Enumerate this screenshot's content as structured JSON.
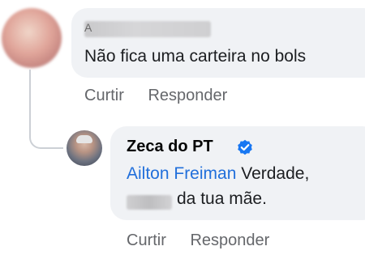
{
  "comment": {
    "author_redacted_visible_char": "A",
    "text": "Não fica uma carteira no bols",
    "actions": {
      "like": "Curtir",
      "reply": "Responder"
    }
  },
  "reply": {
    "author": "Zeca do PT",
    "verified": true,
    "mention": "Ailton Freiman",
    "text_line1": "Verdade,",
    "text_line2": "da tua mãe.",
    "actions": {
      "like": "Curtir",
      "reply": "Responder"
    }
  },
  "colors": {
    "bubble": "#f0f2f5",
    "mention": "#216fdb",
    "secondary_text": "#65676b",
    "verified_badge": "#1877f2"
  },
  "icons": {
    "verified": "verified-badge-icon"
  }
}
